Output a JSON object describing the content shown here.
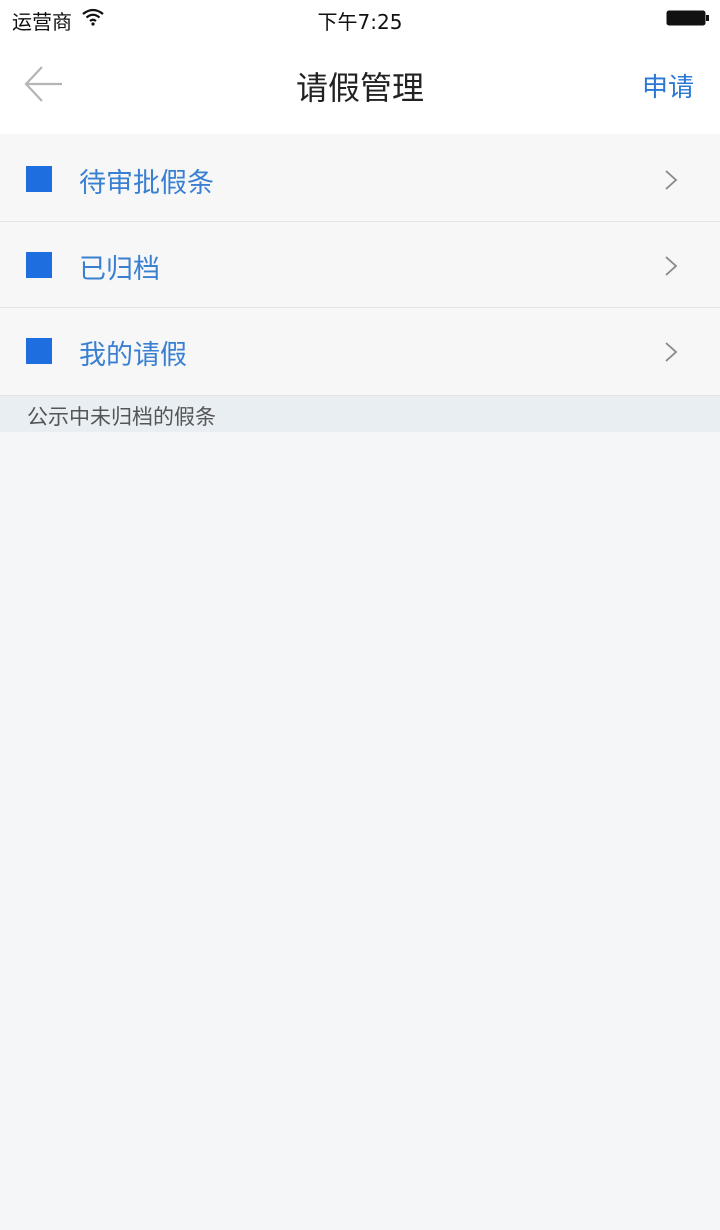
{
  "status_bar": {
    "carrier": "运营商",
    "time": "下午7:25"
  },
  "nav": {
    "title": "请假管理",
    "action_label": "申请",
    "back_icon": "arrow-left-icon"
  },
  "menu": {
    "accent_color": "#1e6ee0",
    "items": [
      {
        "label": "待审批假条",
        "icon": "square-icon"
      },
      {
        "label": "已归档",
        "icon": "square-icon"
      },
      {
        "label": "我的请假",
        "icon": "square-icon"
      }
    ]
  },
  "section": {
    "label": "公示中未归档的假条"
  }
}
